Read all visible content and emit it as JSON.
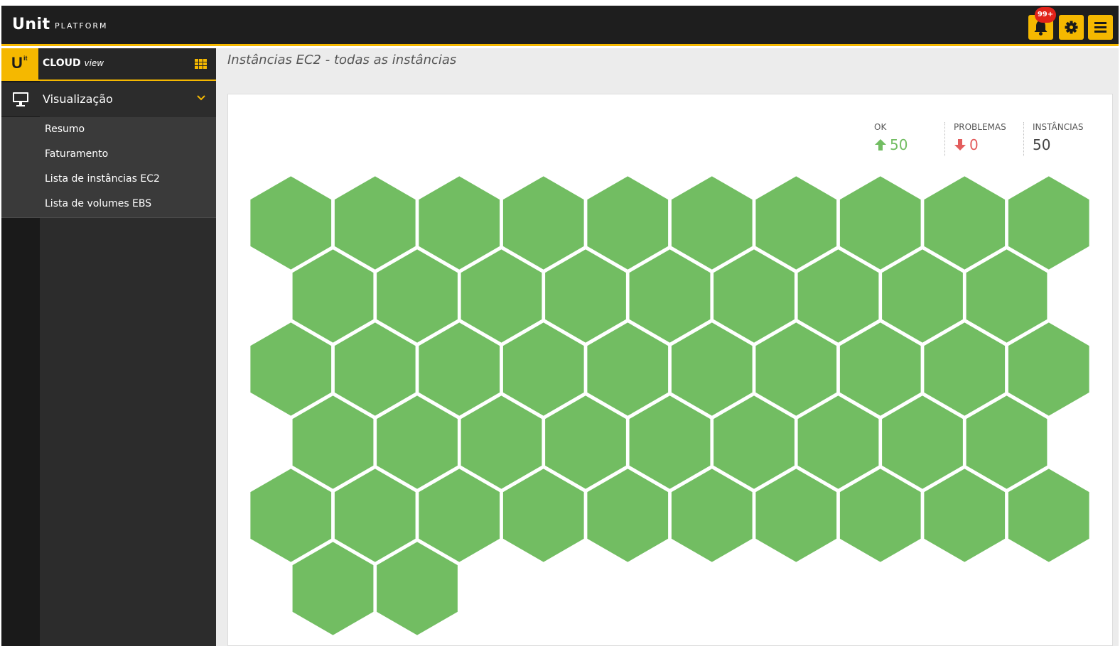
{
  "header": {
    "logo": "Unit",
    "logo_sub": "PLATFORM",
    "notification_badge": "99+",
    "accent_color": "#f5b800",
    "buttons": [
      "bell-icon",
      "gear-icon",
      "hamburger-icon"
    ]
  },
  "sidebar": {
    "brand_letter": "U",
    "brand_sup": "it",
    "brand_title": "CLOUD",
    "brand_subtitle": "view",
    "section_label": "Visualização",
    "items": [
      {
        "label": "Resumo"
      },
      {
        "label": "Faturamento"
      },
      {
        "label": "Lista de instâncias EC2"
      },
      {
        "label": "Lista de volumes EBS"
      }
    ]
  },
  "main": {
    "page_title": "Instâncias EC2 - todas as instâncias",
    "stats": {
      "ok_label": "OK",
      "ok_value": "50",
      "problems_label": "PROBLEMAS",
      "problems_value": "0",
      "instances_label": "INSTÂNCIAS",
      "instances_value": "50"
    },
    "hexmap": {
      "total_instances": 50,
      "ok_instances": 50,
      "problem_instances": 0,
      "ok_color": "#72bd62",
      "problem_color": "#e35d5d"
    }
  }
}
